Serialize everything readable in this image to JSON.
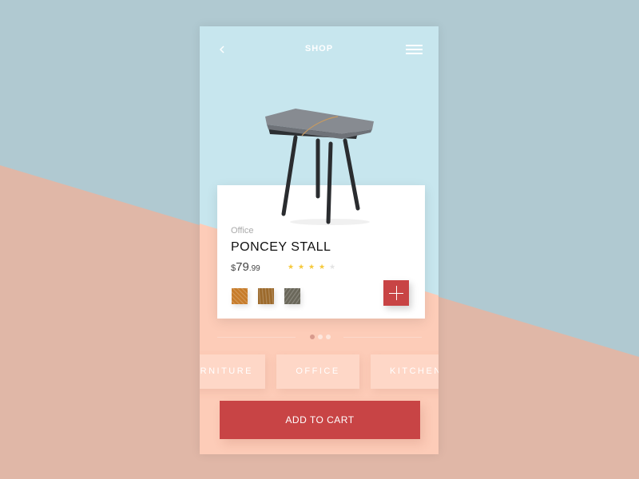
{
  "header": {
    "title": "SHOP",
    "back_icon": "chevron-left-icon",
    "menu_icon": "hamburger-menu-icon"
  },
  "product": {
    "category": "Office",
    "name": "PONCEY STALL",
    "price": {
      "currency": "$",
      "whole": "79",
      "cents": ".99"
    },
    "rating": 4,
    "rating_max": 5,
    "swatches": [
      {
        "name": "orange-marble",
        "color": "#c77c2a"
      },
      {
        "name": "wood-grain",
        "color": "#9c6a2c"
      },
      {
        "name": "dark-stone",
        "color": "#6a675a"
      }
    ],
    "add_button_icon": "plus-icon"
  },
  "pager": {
    "count": 3,
    "active": 0
  },
  "categories": [
    {
      "label": "FURNITURE"
    },
    {
      "label": "OFFICE"
    },
    {
      "label": "KITCHEN"
    }
  ],
  "cart_button": {
    "label": "ADD TO CART"
  },
  "colors": {
    "accent": "#c84445",
    "star_filled": "#f6c93b",
    "star_empty": "#e4e4e4"
  }
}
